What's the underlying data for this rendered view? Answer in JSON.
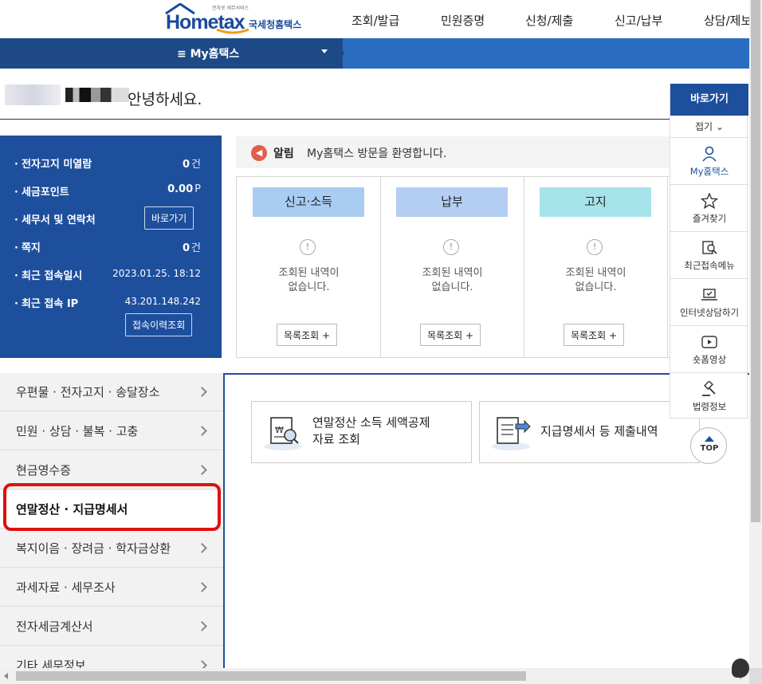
{
  "header": {
    "logo_text": "Hometax",
    "logo_sub": "국세청홈택스",
    "logo_tiny": "전자로 세무서비스",
    "gnb": [
      "조회/발급",
      "민원증명",
      "신청/제출",
      "신고/납부",
      "상담/제보"
    ]
  },
  "navbar": {
    "menu_label": "My홈택스"
  },
  "greeting": {
    "text": "안녕하세요."
  },
  "info": {
    "rows": [
      {
        "label": "전자고지 미열람",
        "value": "0",
        "unit": "건"
      },
      {
        "label": "세금포인트",
        "value": "0.00",
        "unit": "P"
      },
      {
        "label": "세무서 및 연락처",
        "button": "바로가기"
      },
      {
        "label": "쪽지",
        "value": "0",
        "unit": "건"
      },
      {
        "label": "최근 접속일시",
        "value": "2023.01.25.  18:12"
      },
      {
        "label": "최근 접속 IP",
        "value": "43.201.148.242"
      }
    ],
    "history_button": "접속이력조회"
  },
  "alarm": {
    "label": "알림",
    "message": "My홈택스 방문을 환영합니다."
  },
  "cards": [
    {
      "title": "신고·소득",
      "color": "#a9ccf2",
      "empty_line1": "조회된 내역이",
      "empty_line2": "없습니다.",
      "button": "목록조회 +"
    },
    {
      "title": "납부",
      "color": "#b3cdf3",
      "empty_line1": "조회된 내역이",
      "empty_line2": "없습니다.",
      "button": "목록조회 +"
    },
    {
      "title": "고지",
      "color": "#a6e3ea",
      "empty_line1": "조회된 내역이",
      "empty_line2": "없습니다.",
      "button": "목록조회 +"
    }
  ],
  "left_menu": [
    "우편물 · 전자고지 · 송달장소",
    "민원 · 상담 · 불복 · 고충",
    "현금영수증",
    "연말정산 · 지급명세서",
    "복지이음 · 장려금 · 학자금상환",
    "과세자료 · 세무조사",
    "전자세금계산서",
    "기타 세무정보"
  ],
  "tiles": [
    {
      "line1": "연말정산 소득 세액공제",
      "line2": "자료 조회"
    },
    {
      "line1": "지급명세서 등 제출내역"
    }
  ],
  "quick": {
    "title": "바로가기",
    "fold": "접기",
    "items": [
      "My홈택스",
      "즐겨찾기",
      "최근접속메뉴",
      "인터넷상담하기",
      "숏폼영상",
      "법령정보"
    ]
  },
  "top_button": "TOP"
}
